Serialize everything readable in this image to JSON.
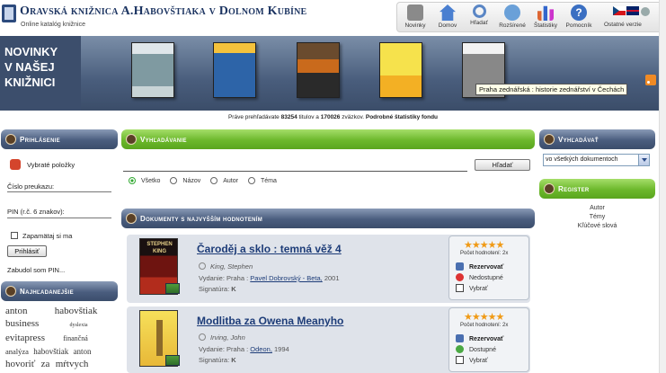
{
  "header": {
    "title": "Oravská knižnica A.Habovštiaka v Dolnom Kubíne",
    "subtitle": "Online katalóg knižnice",
    "nav": [
      {
        "label": "Novinky",
        "icon": "newspaper-icon"
      },
      {
        "label": "Domov",
        "icon": "home-icon"
      },
      {
        "label": "Hľadať",
        "icon": "search-icon"
      },
      {
        "label": "Rozšírené",
        "icon": "advanced-search-icon"
      },
      {
        "label": "Štatistiky",
        "icon": "statistics-icon"
      },
      {
        "label": "Pomocník",
        "icon": "help-icon"
      }
    ],
    "other_versions_label": "Ostatné verzie"
  },
  "banner": {
    "title_lines": [
      "NOVINKY",
      "V NAŠEJ",
      "KNIŽNICI"
    ],
    "tooltip": "Praha zednářská : historie zednářství v Čechách"
  },
  "status": {
    "prefix": "Práve prehľadávate",
    "records": "83254",
    "records_label": "titulov a",
    "items": "170026",
    "items_label": "zväzkov.",
    "link": "Podrobné štatistiky fondu"
  },
  "login": {
    "heading": "Prihlásenie",
    "basket_label": "Vybraté položky",
    "card_label": "Číslo preukazu:",
    "pin_label": "PIN (r.č. 6 znakov):",
    "remember_label": "Zapamätaj si ma",
    "submit_label": "Prihlásiť",
    "forgot_label": "Zabudol som PIN..."
  },
  "popular": {
    "heading": "Najhľadanejšie",
    "tags": [
      "anton",
      "habovštiak",
      "business",
      "dyslexia",
      "evitapress",
      "finančná",
      "analýza",
      "habovštiak",
      "anton",
      "hovoriť",
      "za",
      "mŕtvych"
    ]
  },
  "search": {
    "heading": "Vyhľadávanie",
    "query": "",
    "button_label": "Hľadať",
    "scopes": [
      "Všetko",
      "Názov",
      "Autor",
      "Téma"
    ],
    "selected_scope": "Všetko"
  },
  "top_rated": {
    "heading": "Dokumenty s najvyšším hodnotením",
    "items": [
      {
        "title": "Čaroděj a sklo : temná věž 4",
        "author": "King, Stephen",
        "publication_label": "Vydanie:",
        "publication_place": "Praha :",
        "publisher": "Pavel Dobrovský - Beta,",
        "year": "2001",
        "signature_label": "Signatúra:",
        "signature": "K",
        "stars": "★★★★★",
        "rating_label": "Počet hodnotení: 2x",
        "reserve_label": "Rezervovať",
        "availability": "Nedostupné",
        "select_label": "Vybrať"
      },
      {
        "title": "Modlitba za Owena Meanyho",
        "author": "Irving, John",
        "publication_label": "Vydanie:",
        "publication_place": "Praha :",
        "publisher": "Odeon,",
        "year": "1994",
        "signature_label": "Signatúra:",
        "signature": "K",
        "stars": "★★★★★",
        "rating_label": "Počet hodnotení: 2x",
        "reserve_label": "Rezervovať",
        "availability": "Dostupné",
        "select_label": "Vybrať"
      }
    ]
  },
  "filter": {
    "heading": "Vyhľadávať",
    "selected": "vo všetkých dokumentoch"
  },
  "registry": {
    "heading": "Register",
    "items": [
      "Autor",
      "Témy",
      "Kľúčové slová"
    ]
  },
  "colors": {
    "accent_dark": "#3b4d6b",
    "accent_green": "#6cb82c",
    "link": "#1d3c78",
    "star": "#f09a16"
  }
}
